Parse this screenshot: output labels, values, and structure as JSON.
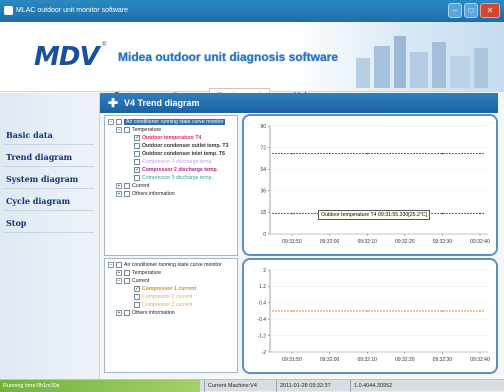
{
  "window": {
    "title": "MLAC outdoor unit monitor software"
  },
  "brand": {
    "logo": "MDV",
    "app_title": "Midea outdoor unit diagnosis software"
  },
  "menu": [
    {
      "label": "System",
      "state": "normal"
    },
    {
      "label": "Set",
      "state": "disabled"
    },
    {
      "label": "Outdoor unit",
      "state": "boxed"
    },
    {
      "label": "Help",
      "state": "normal"
    }
  ],
  "sidebar": {
    "items": [
      {
        "label": "Basic data"
      },
      {
        "label": "Trend diagram"
      },
      {
        "label": "System diagram"
      },
      {
        "label": "Cycle diagram"
      },
      {
        "label": "Stop"
      }
    ]
  },
  "page_header": {
    "title": "V4 Trend diagram"
  },
  "tree1": {
    "root": "Air conditioner running state curve monitor",
    "groups": [
      {
        "label": "Temperature",
        "expanded": true,
        "items": [
          {
            "label": "Outdoor temperature T4",
            "checked": true,
            "color": "#d03060"
          },
          {
            "label": "Outdoor condenser outlet temp. T3",
            "checked": false,
            "color": "#333333"
          },
          {
            "label": "Outdoor condenser inlet temp. T6",
            "checked": false,
            "color": "#333333"
          },
          {
            "label": "Compressor 1 discharge temp.",
            "checked": false,
            "color": "#c8a0e8"
          },
          {
            "label": "Compressor 2 discharge temp.",
            "checked": true,
            "color": "#b02a7a"
          },
          {
            "label": "Compressor 3 discharge temp.",
            "checked": false,
            "color": "#3aa0a0"
          }
        ]
      },
      {
        "label": "Current",
        "expanded": false,
        "items": []
      },
      {
        "label": "Others information",
        "expanded": false,
        "items": []
      }
    ]
  },
  "tree2": {
    "root": "Air conditioner running state curve monitor",
    "groups": [
      {
        "label": "Temperature",
        "expanded": false,
        "items": []
      },
      {
        "label": "Current",
        "expanded": true,
        "items": [
          {
            "label": "Compressor 1 current",
            "checked": true,
            "color": "#e08a2a"
          },
          {
            "label": "Compressor 2 current",
            "checked": false,
            "color": "#e0a870"
          },
          {
            "label": "Compressor 3 current",
            "checked": false,
            "color": "#e0a870"
          }
        ]
      },
      {
        "label": "Others information",
        "expanded": false,
        "items": []
      }
    ]
  },
  "chart_data": [
    {
      "type": "line",
      "x": [
        "09:31:50",
        "09:32:00",
        "09:32:10",
        "09:32:20",
        "09:32:30",
        "09:32:40"
      ],
      "y_ticks": [
        "90",
        "72",
        "54",
        "36",
        "18",
        "0"
      ],
      "ylim": [
        0,
        90
      ],
      "series": [
        {
          "color": "#c0204a",
          "values": [
            67,
            67,
            67,
            67,
            67,
            67
          ]
        },
        {
          "color": "#c0204a",
          "values": [
            17,
            17,
            17,
            17,
            17,
            17
          ]
        }
      ],
      "tooltip": "Outdoor temperature T4 09:31:55.330[25.2°C]",
      "grid": true
    },
    {
      "type": "line",
      "x": [
        "09:31:50",
        "09:32:00",
        "09:32:10",
        "09:32:20",
        "09:32:30",
        "09:32:40"
      ],
      "y_ticks": [
        "2",
        "1.2",
        "0.4",
        "-0.4",
        "-1.2",
        "-2"
      ],
      "ylim": [
        -2,
        2
      ],
      "series": [
        {
          "color": "#e08a2a",
          "values": [
            0,
            0,
            0,
            0,
            0,
            0
          ]
        }
      ],
      "grid": true
    }
  ],
  "status_bar": {
    "running_time": "Running time:0h1m30s",
    "machine": "Current Machine:V4",
    "datetime": "2011-01-28 09:32:37",
    "version": "1.0.4044.30952"
  }
}
